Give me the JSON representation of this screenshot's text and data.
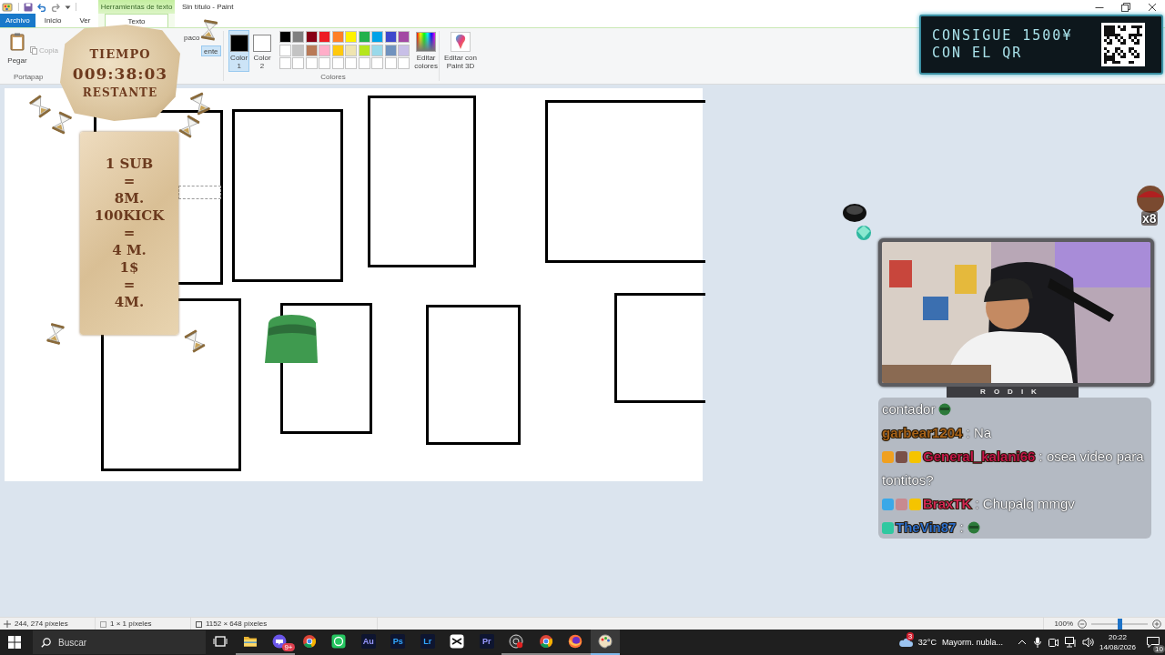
{
  "window": {
    "title": "Sin título - Paint",
    "context_tab": "Herramientas de texto"
  },
  "tabs": [
    {
      "label": "Archivo",
      "kind": "file",
      "selected": false
    },
    {
      "label": "Inicio",
      "kind": "tab",
      "selected": false
    },
    {
      "label": "Ver",
      "kind": "tab",
      "selected": false
    },
    {
      "label": "Texto",
      "kind": "context",
      "selected": true
    }
  ],
  "ribbon": {
    "clipboard": {
      "paste": "Pegar",
      "copy": {
        "label": "Copia",
        "disabled": true
      },
      "group": "Portapap"
    },
    "background_mode": [
      {
        "label": "paco",
        "selected": false
      },
      {
        "label": "ente",
        "selected": true
      }
    ],
    "color_slots": [
      {
        "label": "Color 1",
        "color": "#000000",
        "selected": true
      },
      {
        "label": "Color 2",
        "color": "#ffffff",
        "selected": false
      }
    ],
    "palette": [
      {
        "color": "#000000"
      },
      {
        "color": "#7f7f7f"
      },
      {
        "color": "#880015"
      },
      {
        "color": "#ed1c24"
      },
      {
        "color": "#ff7f27"
      },
      {
        "color": "#fff200"
      },
      {
        "color": "#22b14c"
      },
      {
        "color": "#00a2e8"
      },
      {
        "color": "#3f48cc"
      },
      {
        "color": "#a349a4"
      },
      {
        "color": "#ffffff"
      },
      {
        "color": "#c3c3c3"
      },
      {
        "color": "#b97a57"
      },
      {
        "color": "#ffaec9"
      },
      {
        "color": "#ffc90e"
      },
      {
        "color": "#efe4b0"
      },
      {
        "color": "#b5e61d"
      },
      {
        "color": "#99d9ea"
      },
      {
        "color": "#7092be"
      },
      {
        "color": "#c8bfe7"
      }
    ],
    "edit_colors": "Editar colores",
    "colors_group": "Colores",
    "paint3d": "Editar con Paint 3D"
  },
  "status_bar": {
    "cursor": "244, 274 píxeles",
    "selection": "1 × 1 píxeles",
    "canvas_size": "1152 × 648 píxeles",
    "zoom": "100%",
    "zoom_slider": {
      "level": 0.5
    }
  },
  "taskbar": {
    "search": {
      "placeholder": "Buscar"
    },
    "apps": [
      {
        "kind": "taskview",
        "running": false,
        "selected": false
      },
      {
        "kind": "folder",
        "running": true,
        "selected": false
      },
      {
        "kind": "chat",
        "badge": "9+",
        "running": true,
        "selected": false
      },
      {
        "kind": "browser",
        "running": false,
        "selected": false
      },
      {
        "kind": "messenger",
        "running": false,
        "selected": false
      },
      {
        "kind": "letter",
        "label": "Au",
        "color": "#9999ff",
        "running": false,
        "selected": false
      },
      {
        "kind": "letter",
        "label": "Ps",
        "color": "#31a8ff",
        "running": false,
        "selected": false
      },
      {
        "kind": "letter",
        "label": "Lr",
        "color": "#31a8ff",
        "running": false,
        "selected": false
      },
      {
        "kind": "editor",
        "running": false,
        "selected": false
      },
      {
        "kind": "letter",
        "label": "Pr",
        "color": "#9999ff",
        "running": false,
        "selected": false
      },
      {
        "kind": "recorder",
        "running": true,
        "selected": false
      },
      {
        "kind": "browser",
        "running": true,
        "selected": false
      },
      {
        "kind": "firefox",
        "running": true,
        "selected": false
      },
      {
        "kind": "paint",
        "running": true,
        "selected": true
      }
    ],
    "weather": {
      "badge": "3",
      "temperature": "32°C",
      "condition": "Mayorm. nubla..."
    },
    "time": "20:22",
    "date": "14/08/2026",
    "notifications": "10"
  },
  "overlays": {
    "timer": {
      "title": "TIEMPO",
      "value": "009:38:03",
      "caption": "RESTANTE"
    },
    "rules": {
      "lines": [
        "1 SUB",
        "=",
        "8M.",
        "100KICK",
        "=",
        "4 M.",
        "1$",
        "=",
        "4M."
      ]
    },
    "promo": {
      "lines": [
        "CONSIGUE 1500¥",
        "CON EL QR"
      ]
    },
    "sticker": {
      "count": "x8"
    },
    "webcam": {
      "kind": "picture",
      "label": "RODIK"
    },
    "chat": {
      "messages": [
        {
          "text": "contador",
          "emote": true
        },
        {
          "user": "garbear1204",
          "color": "#a8641a",
          "text": ": Na",
          "emote": false
        },
        {
          "badges": [
            {
              "color": "#f0a020"
            },
            {
              "color": "#7a5048"
            },
            {
              "color": "#f5c400"
            }
          ],
          "user": "General_kalani66",
          "color": "#c41848",
          "text": ": osea video para tontitos?",
          "emote": false
        },
        {
          "badges": [
            {
              "color": "#3aa8e8"
            },
            {
              "color": "#c88a90"
            },
            {
              "color": "#f5c400"
            }
          ],
          "user": "BraxTK",
          "color": "#d02850",
          "text": ": Chupalq mmgv",
          "emote": false
        },
        {
          "badges": [
            {
              "color": "#30c8a0"
            }
          ],
          "user": "TheVin87",
          "color": "#2f6fc8",
          "text": ":",
          "emote": true
        }
      ]
    }
  }
}
